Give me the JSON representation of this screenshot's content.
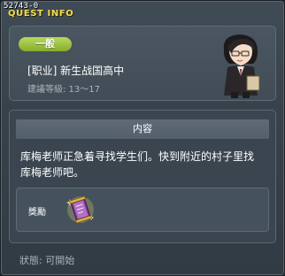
{
  "window": {
    "quest_id": "52743-0",
    "title": "QUEST INFO"
  },
  "quest": {
    "category_badge": "一般",
    "name": "[职业] 新生战国高中",
    "required_level": "建議等級: 13～17"
  },
  "content": {
    "header": "内容",
    "description_line1": "库梅老师正急着寻找学生们。快到附近的村子里找",
    "description_line2": "库梅老师吧。"
  },
  "reward": {
    "label": "獎勵",
    "item_icon": "scroll-item-icon"
  },
  "status": {
    "text": "狀態:  可開始"
  },
  "colors": {
    "title": "#f3de4c",
    "badge": "#9bc33e",
    "panel": "#3a4550",
    "window": "#37424c"
  }
}
